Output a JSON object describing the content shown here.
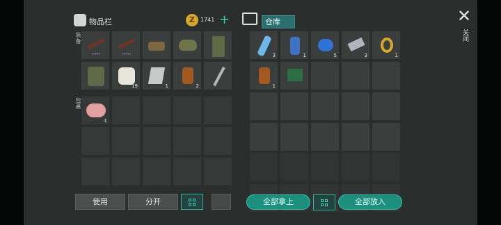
{
  "inventory_tab": {
    "title": "物品栏",
    "coins": "1741"
  },
  "warehouse": {
    "title": "仓库"
  },
  "close": {
    "label": "关闭"
  },
  "side_labels": {
    "equip": "装备",
    "bag": "包裹"
  },
  "equipment": [
    {
      "icon": "rifle-icon",
      "qty": "",
      "mods": "•••••"
    },
    {
      "icon": "rifle-icon",
      "qty": "",
      "mods": "•••••"
    },
    {
      "icon": "boots-icon",
      "qty": ""
    },
    {
      "icon": "helmet-icon",
      "qty": ""
    },
    {
      "icon": "pants-icon",
      "qty": ""
    },
    {
      "icon": "vest-icon",
      "qty": ""
    },
    {
      "icon": "bandage-icon",
      "qty": "19"
    },
    {
      "icon": "metal-plate-icon",
      "qty": "1"
    },
    {
      "icon": "bottle-icon",
      "qty": "2"
    },
    {
      "icon": "shovel-icon",
      "qty": ""
    }
  ],
  "bag_slots": [
    {
      "icon": "chicken-icon",
      "qty": "1"
    },
    {},
    {},
    {},
    {},
    {},
    {},
    {},
    {},
    {},
    {},
    {},
    {},
    {},
    {}
  ],
  "storage_slots": [
    {
      "icon": "water-bottle-icon",
      "qty": "3"
    },
    {
      "icon": "can-icon",
      "qty": "1"
    },
    {
      "icon": "tape-icon",
      "qty": "5"
    },
    {
      "icon": "scrap-icon",
      "qty": "3"
    },
    {
      "icon": "watch-icon",
      "qty": "1"
    },
    {
      "icon": "bottle-icon",
      "qty": "1"
    },
    {
      "icon": "battery-icon",
      "qty": ""
    },
    {},
    {},
    {},
    {},
    {},
    {},
    {},
    {},
    {},
    {},
    {},
    {},
    {},
    {},
    {},
    {},
    {},
    {},
    {},
    {},
    {},
    {},
    {}
  ],
  "buttons": {
    "use": "使用",
    "split": "分开",
    "take_all": "全部拿上",
    "put_all": "全部放入"
  },
  "colors": {
    "accent": "#1c8f7d",
    "slot": "#3a3f3e",
    "bg": "#2a2e2d"
  }
}
